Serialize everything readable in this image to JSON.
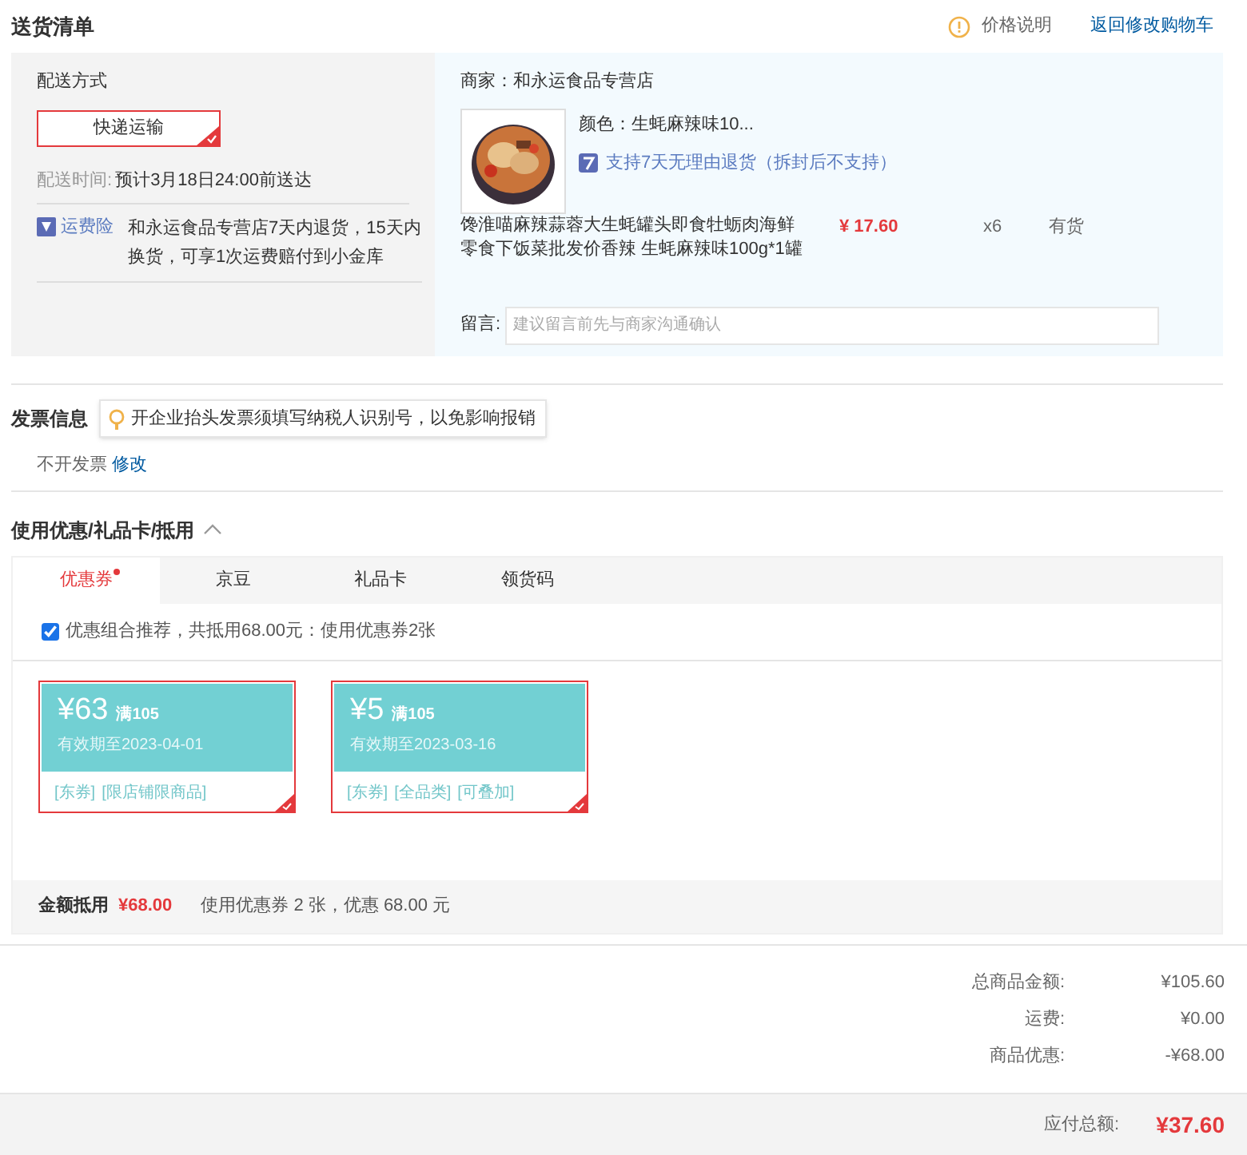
{
  "header": {
    "title": "送货清单",
    "price_note": "价格说明",
    "back_link": "返回修改购物车"
  },
  "shipping": {
    "label": "配送方式",
    "method": {
      "label": "快递运输",
      "selected": true
    },
    "time_label": "配送时间:",
    "time_value": "预计3月18日24:00前送达",
    "insurance_label": "运费险",
    "insurance_text": "和永运食品专营店7天内退货，15天内换货，可享1次运费赔付到小金库"
  },
  "order": {
    "shop": "商家：和永运食品专营店",
    "color_spec": "颜色：生蚝麻辣味10...",
    "return_policy": "支持7天无理由退货（拆封后不支持）",
    "product_name": "馋淮喵麻辣蒜蓉大生蚝罐头即食牡蛎肉海鲜零食下饭菜批发价香辣 生蚝麻辣味100g*1罐",
    "price": "¥ 17.60",
    "quantity": "x6",
    "stock": "有货",
    "note_label": "留言:",
    "note_placeholder": "建议留言前先与商家沟通确认"
  },
  "invoice": {
    "title": "发票信息",
    "tip": "开企业抬头发票须填写纳税人识别号，以免影响报销",
    "status": "不开发票",
    "edit_link": "修改"
  },
  "discounts": {
    "title": "使用优惠/礼品卡/抵用",
    "expanded": true,
    "tabs": [
      {
        "label": "优惠券",
        "selected": true,
        "dot": true
      },
      {
        "label": "京豆",
        "selected": false,
        "dot": false
      },
      {
        "label": "礼品卡",
        "selected": false,
        "dot": false
      },
      {
        "label": "领货码",
        "selected": false,
        "dot": false
      }
    ],
    "combo": {
      "checked": true,
      "text": "优惠组合推荐，共抵用68.00元：使用优惠券2张"
    },
    "coupons": [
      {
        "amount": "¥63",
        "threshold": "满105",
        "validity": "有效期至2023-04-01",
        "tags": [
          "[东券]",
          "[限店铺限商品]"
        ],
        "selected": true
      },
      {
        "amount": "¥5",
        "threshold": "满105",
        "validity": "有效期至2023-03-16",
        "tags": [
          "[东券]",
          "[全品类]",
          "[可叠加]"
        ],
        "selected": true
      }
    ],
    "summary": {
      "label": "金额抵用",
      "amount": "¥68.00",
      "text": "使用优惠券 2 张，优惠 68.00 元"
    }
  },
  "totals": [
    {
      "label": "总商品金额:",
      "value": "¥105.60"
    },
    {
      "label": "运费:",
      "value": "¥0.00"
    },
    {
      "label": "商品优惠:",
      "value": "-¥68.00"
    }
  ],
  "payable": {
    "label": "应付总额:",
    "value": "¥37.60"
  }
}
